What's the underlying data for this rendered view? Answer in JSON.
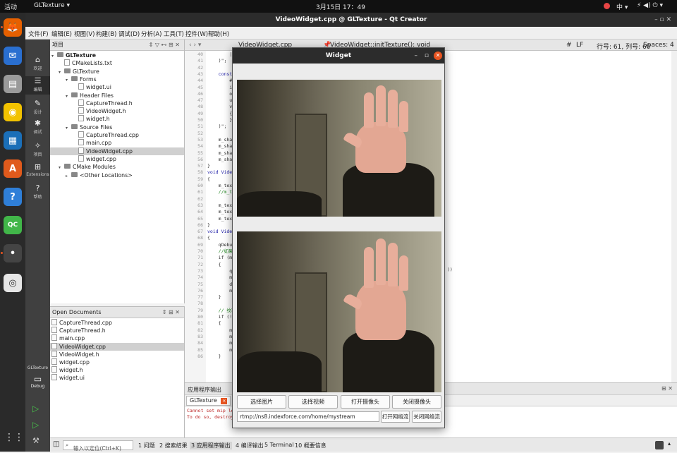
{
  "topbar": {
    "activities": "活动",
    "app_menu": "GLTexture ▾",
    "clock": "3月15日  17：49",
    "input_method": "中 ▾",
    "system_icons": "⚡ ◀) ⏻ ▾"
  },
  "qt": {
    "window_title": "VideoWidget.cpp @ GLTexture - Qt Creator",
    "window_buttons": "–   ▫   ✕",
    "menu": [
      "文件(F)",
      "编辑(E)",
      "视图(V)",
      "构建(B)",
      "调试(D)",
      "分析(A)",
      "工具(T)",
      "控件(W)",
      "帮助(H)"
    ],
    "modes": [
      {
        "label": "欢迎",
        "icon": "home-icon",
        "glyph": "⌂"
      },
      {
        "label": "编辑",
        "icon": "edit-icon",
        "glyph": "☰"
      },
      {
        "label": "设计",
        "icon": "design-icon",
        "glyph": "✎"
      },
      {
        "label": "调试",
        "icon": "debug-icon",
        "glyph": "✱"
      },
      {
        "label": "项目",
        "icon": "wrench-icon",
        "glyph": "✧"
      },
      {
        "label": "Extensions",
        "icon": "extensions-icon",
        "glyph": "⊞"
      },
      {
        "label": "帮助",
        "icon": "help-icon",
        "glyph": "?"
      }
    ],
    "kit": {
      "project": "GLTexture",
      "mode": "Debug"
    },
    "project_panel": {
      "title": "项目",
      "tree": [
        {
          "label": "GLTexture",
          "depth": 0,
          "kind": "project",
          "arrow": "▾"
        },
        {
          "label": "CMakeLists.txt",
          "depth": 1,
          "kind": "file",
          "arrow": ""
        },
        {
          "label": "GLTexture",
          "depth": 1,
          "kind": "target",
          "arrow": "▾"
        },
        {
          "label": "Forms",
          "depth": 2,
          "kind": "folder",
          "arrow": "▾"
        },
        {
          "label": "widget.ui",
          "depth": 3,
          "kind": "file",
          "arrow": ""
        },
        {
          "label": "Header Files",
          "depth": 2,
          "kind": "folder",
          "arrow": "▾"
        },
        {
          "label": "CaptureThread.h",
          "depth": 3,
          "kind": "file",
          "arrow": ""
        },
        {
          "label": "VideoWidget.h",
          "depth": 3,
          "kind": "file",
          "arrow": ""
        },
        {
          "label": "widget.h",
          "depth": 3,
          "kind": "file",
          "arrow": ""
        },
        {
          "label": "Source Files",
          "depth": 2,
          "kind": "folder",
          "arrow": "▾"
        },
        {
          "label": "CaptureThread.cpp",
          "depth": 3,
          "kind": "file",
          "arrow": ""
        },
        {
          "label": "main.cpp",
          "depth": 3,
          "kind": "file",
          "arrow": ""
        },
        {
          "label": "VideoWidget.cpp",
          "depth": 3,
          "kind": "file",
          "arrow": "",
          "selected": true
        },
        {
          "label": "widget.cpp",
          "depth": 3,
          "kind": "file",
          "arrow": ""
        },
        {
          "label": "CMake Modules",
          "depth": 1,
          "kind": "folder",
          "arrow": "▾"
        },
        {
          "label": "<Other Locations>",
          "depth": 2,
          "kind": "folder",
          "arrow": "▸"
        }
      ]
    },
    "open_documents": {
      "title": "Open Documents",
      "files": [
        "CaptureThread.cpp",
        "CaptureThread.h",
        "main.cpp",
        "VideoWidget.cpp",
        "VideoWidget.h",
        "widget.cpp",
        "widget.h",
        "widget.ui"
      ],
      "selected": "VideoWidget.cpp"
    },
    "editor_bar": {
      "file": "VideoWidget.cpp",
      "symbol": "VideoWidget::initTexture(): void",
      "hash": "#",
      "line_ending": "LF",
      "position": "行号: 61, 列号: 60",
      "spaces": "Spaces: 4"
    },
    "code_lines": [
      {
        "n": "40",
        "t": "        |"
      },
      {
        "n": "41",
        "t": "    )\";"
      },
      {
        "n": "42",
        "t": ""
      },
      {
        "n": "43",
        "t": "    const"
      },
      {
        "n": "44",
        "t": "        #v"
      },
      {
        "n": "45",
        "t": "        in"
      },
      {
        "n": "46",
        "t": "        ou"
      },
      {
        "n": "47",
        "t": "        un"
      },
      {
        "n": "48",
        "t": "        vo"
      },
      {
        "n": "49",
        "t": "        {"
      },
      {
        "n": "50",
        "t": "        }"
      },
      {
        "n": "51",
        "t": "    )\";"
      },
      {
        "n": "52",
        "t": ""
      },
      {
        "n": "53",
        "t": "    m_shad"
      },
      {
        "n": "54",
        "t": "    m_sha"
      },
      {
        "n": "55",
        "t": "    m_sha"
      },
      {
        "n": "56",
        "t": "    m_shad"
      },
      {
        "n": "57",
        "t": "}"
      },
      {
        "n": "58",
        "t": "void Video"
      },
      {
        "n": "59",
        "t": "{"
      },
      {
        "n": "60",
        "t": "    m_text"
      },
      {
        "n": "61",
        "t": "    //m_te"
      },
      {
        "n": "62",
        "t": ""
      },
      {
        "n": "63",
        "t": "    m_text"
      },
      {
        "n": "64",
        "t": "    m_text"
      },
      {
        "n": "65",
        "t": "    m_text"
      },
      {
        "n": "66",
        "t": "}"
      },
      {
        "n": "67",
        "t": "void Video"
      },
      {
        "n": "68",
        "t": "{"
      },
      {
        "n": "69",
        "t": "    qDebug"
      },
      {
        "n": "70",
        "t": "    //如果"
      },
      {
        "n": "71",
        "t": "    if (m_"
      },
      {
        "n": "72",
        "t": "    {"
      },
      {
        "n": "73",
        "t": "        qD"
      },
      {
        "n": "74",
        "t": "        m_"
      },
      {
        "n": "75",
        "t": "        de"
      },
      {
        "n": "76",
        "t": "        m_"
      },
      {
        "n": "77",
        "t": "    }"
      },
      {
        "n": "78",
        "t": ""
      },
      {
        "n": "79",
        "t": "    // 纹理"
      },
      {
        "n": "80",
        "t": "    if (!m"
      },
      {
        "n": "81",
        "t": "    {"
      },
      {
        "n": "82",
        "t": "        m_"
      },
      {
        "n": "83",
        "t": "        m_"
      },
      {
        "n": "84",
        "t": "        m_"
      },
      {
        "n": "85",
        "t": "        m_"
      },
      {
        "n": "86",
        "t": "    }"
      }
    ],
    "code_fragment_right": "))",
    "output": {
      "title": "应用程序输出",
      "tab": "GLTexture",
      "lines": [
        "Cannot set mip lev",
        "To do so, destroy("
      ]
    },
    "statusbar": {
      "locator_placeholder": "输入以定位(Ctrl+K)",
      "tabs": [
        "1 问题",
        "2 搜索结果",
        "3 应用程序输出",
        "4 编译输出",
        "5 Terminal",
        "10 概要信息"
      ]
    }
  },
  "widget": {
    "title": "Widget",
    "buttons_row1": [
      "选择图片",
      "选择视频",
      "打开摄像头",
      "关闭摄像头"
    ],
    "url": "rtmp://ns8.indexforce.com/home/mystream",
    "buttons_row2": [
      "打开网络流",
      "关闭网络流"
    ]
  },
  "dock_apps": [
    {
      "name": "firefox-icon",
      "color": "#e66000",
      "glyph": "🦊"
    },
    {
      "name": "thunderbird-icon",
      "color": "#2a6fd0",
      "glyph": "✉"
    },
    {
      "name": "files-icon",
      "color": "#9a9a9a",
      "glyph": "▤"
    },
    {
      "name": "rhythmbox-icon",
      "color": "#f2c200",
      "glyph": "◉"
    },
    {
      "name": "writer-icon",
      "color": "#1b6fb8",
      "glyph": "▦"
    },
    {
      "name": "software-icon",
      "color": "#e05a1c",
      "glyph": "A"
    },
    {
      "name": "help-icon",
      "color": "#2f7fd8",
      "glyph": "?"
    },
    {
      "name": "qtcreator-icon",
      "color": "#41b649",
      "glyph": "QC"
    },
    {
      "name": "app-active-icon",
      "color": "#444444",
      "glyph": "•"
    },
    {
      "name": "dvd-icon",
      "color": "#e6e6e6",
      "glyph": "◎"
    }
  ]
}
